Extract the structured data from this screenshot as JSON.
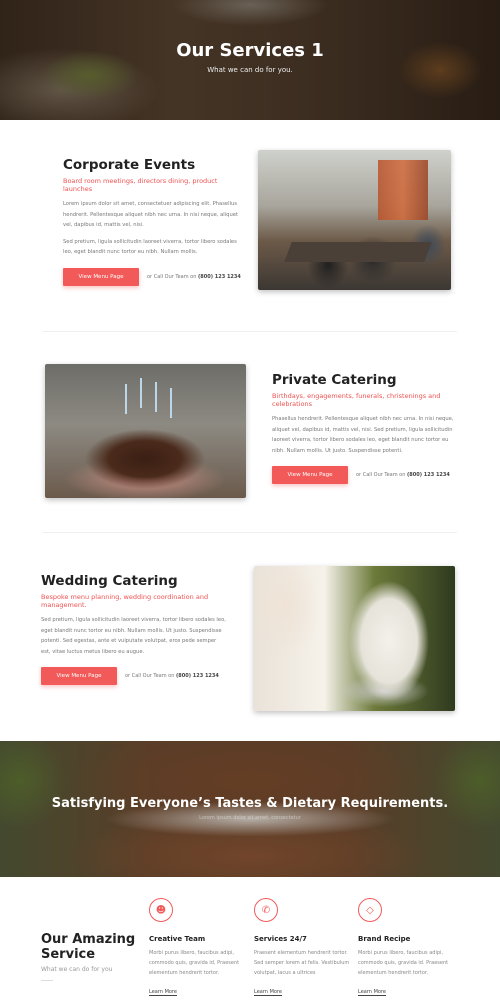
{
  "hero": {
    "title": "Our Services 1",
    "subtitle": "What we can do for you."
  },
  "services": [
    {
      "title": "Corporate Events",
      "tagline": "Board room meetings, directors dining, product launches",
      "paragraphs": [
        "Lorem ipsum dolor sit amet, consectetuer adipiscing elit. Phasellus hendrerit. Pellentesque aliquet nibh nec urna. In nisi neque, aliquet vel, dapibus id, mattis vel, nisi.",
        "Sed pretium, ligula sollicitudin laoreet viverra, tortor libero sodales leo, eget blandit nunc tortor eu nibh. Nullam mollis."
      ],
      "button": "View Menu Page",
      "call_prefix": "or Call Our Team on",
      "phone": "(800) 123 1234"
    },
    {
      "title": "Private Catering",
      "tagline": "Birthdays, engagements, funerals, christenings and celebrations",
      "paragraphs": [
        "Phasellus hendrerit. Pellentesque aliquet nibh nec urna. In nisi neque, aliquet vel, dapibus id, mattis vel, nisi. Sed pretium, ligula sollicitudin laoreet viverra, tortor libero sodales leo, eget blandit nunc tortor eu nibh. Nullam mollis. Ut justo. Suspendisse potenti."
      ],
      "button": "View Menu Page",
      "call_prefix": "or Call Our Team on",
      "phone": "(800) 123 1234"
    },
    {
      "title": "Wedding Catering",
      "tagline": "Bespoke menu planning, wedding coordination and management.",
      "paragraphs": [
        "Sed pretium, ligula sollicitudin laoreet viverra, tortor libero sodales leo, eget blandit nunc tortor eu nibh. Nullam mollis. Ut justo. Suspendisse potenti. Sed egestas, ante et vulputate volutpat, eros pede semper est, vitae luctus metus libero eu augue."
      ],
      "button": "View Menu Page",
      "call_prefix": "or Call Our Team on",
      "phone": "(800) 123 1234"
    }
  ],
  "banner": {
    "title": "Satisfying Everyone’s Tastes & Dietary Requirements.",
    "subtitle": "Lorem ipsum dolor sit amet, consectetur"
  },
  "amazing": {
    "title": "Our Amazing Service",
    "subtitle": "What we can do for you"
  },
  "features": [
    {
      "icon": "team-icon",
      "title": "Creative Team",
      "text": "Morbi purus libero, faucibus adipi, commodo quis, gravida id, Praesent elementum hendrerit tortor.",
      "link": "Learn More"
    },
    {
      "icon": "phone-icon",
      "title": "Services 24/7",
      "text": "Praesent elementum hendrerit tortor. Sed semper lorem at felis. Vestibulum volutpat, lacus a ultrices",
      "link": "Learn More"
    },
    {
      "icon": "diamond-icon",
      "title": "Brand Recipe",
      "text": "Morbi purus libero, faucibus adipi, commodo quis, gravida id. Praesent elementum hendrerit tortor.",
      "link": "Learn More"
    }
  ],
  "colors": {
    "accent": "#f25a5a",
    "tagline": "#ef5050"
  }
}
